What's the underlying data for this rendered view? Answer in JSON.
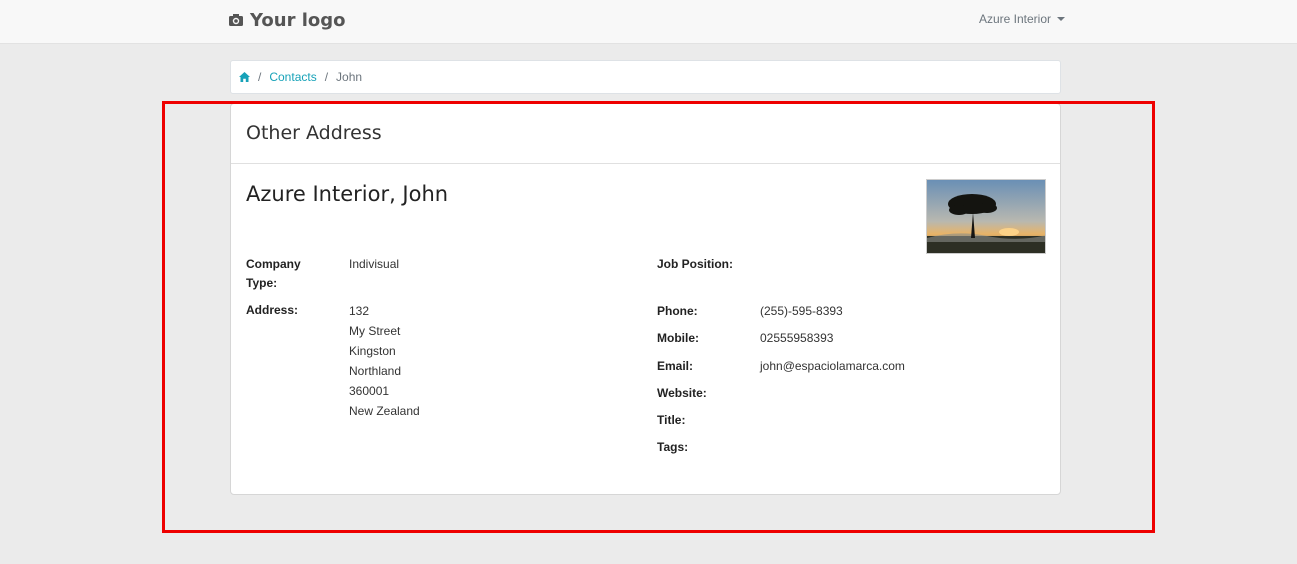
{
  "navbar": {
    "logo_text": "Your logo",
    "user_menu_label": "Azure Interior"
  },
  "breadcrumb": {
    "contacts_label": "Contacts",
    "current_label": "John",
    "separator": "/"
  },
  "card": {
    "header_title": "Other Address",
    "contact_name": "Azure Interior, John",
    "photo_alt": "tree at sunset",
    "left_fields": {
      "company_type_label_line1": "Company",
      "company_type_label_line2": "Type:",
      "company_type_value": "Indivisual",
      "address_label": "Address:",
      "address_lines": [
        "132",
        "My Street",
        "Kingston",
        "Northland",
        "360001",
        "New Zealand"
      ]
    },
    "right_fields": {
      "job_position_label": "Job Position:",
      "phone_label": "Phone:",
      "phone_value": "(255)-595-8393",
      "mobile_label": "Mobile:",
      "mobile_value": "02555958393",
      "email_label": "Email:",
      "email_value": "john@espaciolamarca.com",
      "website_label": "Website:",
      "title_label": "Title:",
      "tags_label": "Tags:"
    }
  },
  "colors": {
    "link": "#17a2b8",
    "highlight": "#e00000",
    "background": "#ebebeb"
  }
}
